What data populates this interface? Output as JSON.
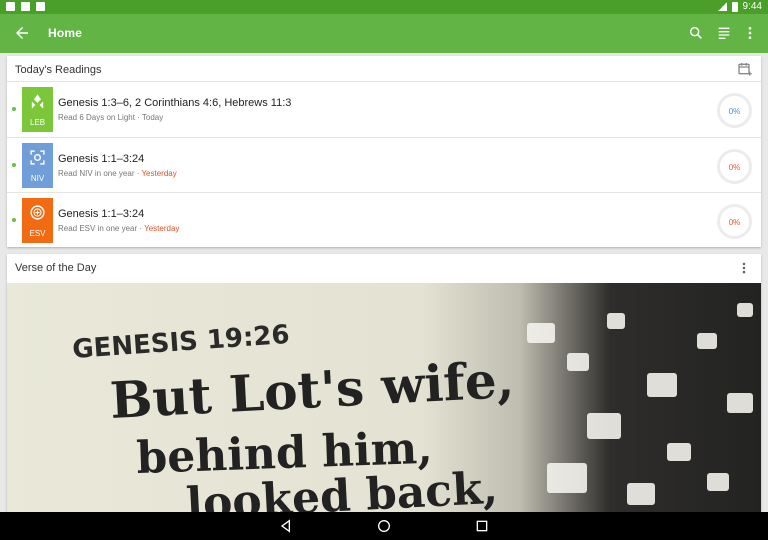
{
  "status_bar": {
    "time": "9:44"
  },
  "app_bar": {
    "title": "Home"
  },
  "readings": {
    "title": "Today's Readings",
    "items": [
      {
        "badge": "LEB",
        "color": "#7cc63a",
        "title": "Genesis 1:3–6, 2 Corinthians 4:6, Hebrews 11:3",
        "plan": "Read 6 Days on Light · ",
        "when": "Today",
        "late": false,
        "progress": "0%"
      },
      {
        "badge": "NIV",
        "color": "#6f9ed8",
        "title": "Genesis 1:1–3:24",
        "plan": "Read NIV in one year · ",
        "when": "Yesterday",
        "late": true,
        "progress": "0%"
      },
      {
        "badge": "ESV",
        "color": "#f26a12",
        "title": "Genesis 1:1–3:24",
        "plan": "Read ESV in one year · ",
        "when": "Yesterday",
        "late": true,
        "progress": "0%"
      }
    ]
  },
  "votd": {
    "title": "Verse of the Day",
    "lines": [
      "GENESIS 19:26",
      "But Lot's wife,",
      "behind him,",
      "looked back,"
    ]
  }
}
